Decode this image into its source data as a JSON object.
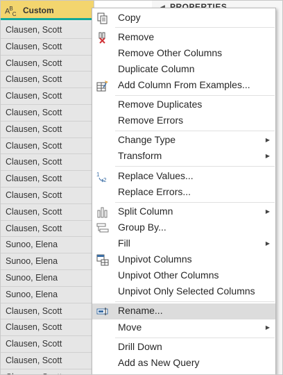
{
  "grid": {
    "column_header": {
      "type_icon": "ABC",
      "name": "Custom"
    },
    "rows": [
      "Clausen, Scott",
      "Clausen, Scott",
      "Clausen, Scott",
      "Clausen, Scott",
      "Clausen, Scott",
      "Clausen, Scott",
      "Clausen, Scott",
      "Clausen, Scott",
      "Clausen, Scott",
      "Clausen, Scott",
      "Clausen, Scott",
      "Clausen, Scott",
      "Clausen, Scott",
      "Sunoo, Elena",
      "Sunoo, Elena",
      "Sunoo, Elena",
      "Sunoo, Elena",
      "Clausen, Scott",
      "Clausen, Scott",
      "Clausen, Scott",
      "Clausen, Scott",
      "Clausen, Scott"
    ]
  },
  "panel": {
    "title": "PROPERTIES"
  },
  "menu": {
    "copy": "Copy",
    "remove": "Remove",
    "remove_other_columns": "Remove Other Columns",
    "duplicate_column": "Duplicate Column",
    "add_column_from_examples": "Add Column From Examples...",
    "remove_duplicates": "Remove Duplicates",
    "remove_errors": "Remove Errors",
    "change_type": "Change Type",
    "transform": "Transform",
    "replace_values": "Replace Values...",
    "replace_errors": "Replace Errors...",
    "split_column": "Split Column",
    "group_by": "Group By...",
    "fill": "Fill",
    "unpivot_columns": "Unpivot Columns",
    "unpivot_other_columns": "Unpivot Other Columns",
    "unpivot_only_selected_columns": "Unpivot Only Selected Columns",
    "rename": "Rename...",
    "move": "Move",
    "drill_down": "Drill Down",
    "add_as_new_query": "Add as New Query"
  },
  "colors": {
    "header_bg": "#f3d56e",
    "header_underline": "#14a898",
    "highlight": "#dcdcdc",
    "remove_x": "#d13438",
    "icon_blue": "#3b6ea5"
  }
}
